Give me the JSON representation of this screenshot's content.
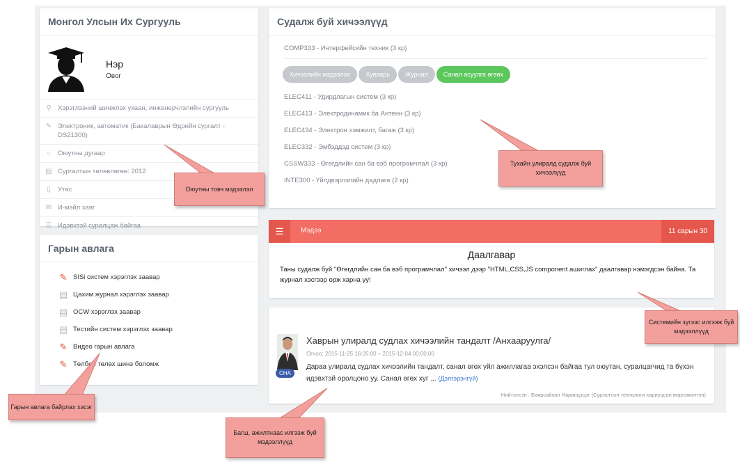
{
  "student": {
    "university": "Монгол Улсын Их Сургууль",
    "name": "Нэр",
    "surname": "Овог",
    "info": [
      {
        "icon": "location-icon",
        "text": "Хэрэглээний шинжлэх ухаан, инженерчлэлийн сургууль"
      },
      {
        "icon": "pencil-icon",
        "text": "Электроник, автоматик (Бакалаврын Өдрийн сургалт - DS21300)"
      },
      {
        "icon": "id-icon",
        "text": "Оюутны дугаар"
      },
      {
        "icon": "calendar-icon",
        "text": "Сургалтын төлөвлөгөө: 2012"
      },
      {
        "icon": "phone-icon",
        "text": "Утас"
      },
      {
        "icon": "mail-icon",
        "text": "И-мэйл хаяг"
      },
      {
        "icon": "list-icon",
        "text": "Идэвхтэй суралцаж байгаа"
      }
    ]
  },
  "manuals": {
    "title": "Гарын авлага",
    "items": [
      {
        "icon": "pdf-icon",
        "label": "SISi систем хэрэглэх заавар"
      },
      {
        "icon": "doc-icon",
        "label": "Цахим журнал хэрэглэх заавар"
      },
      {
        "icon": "doc-icon",
        "label": "OCW хэрэглэх заавар"
      },
      {
        "icon": "doc-icon",
        "label": "Тестийн систем хэрэглэх заавар"
      },
      {
        "icon": "pdf-icon",
        "label": "Видео гарын авлага"
      },
      {
        "icon": "pdf-icon",
        "label": "Төлбөр төлөх шинэ боломж"
      }
    ]
  },
  "courses": {
    "title": "Судалж буй хичээлүүд",
    "first": "COMP333 - Интерфейсийн техник (3 кр)",
    "tabs": [
      "Хичээлийн мэдээлэл",
      "Хуваарь",
      "Журнал",
      "Санал асуулга өгөөх"
    ],
    "list": [
      "ELEC411 - Удирдлагын систем (3 кр)",
      "ELEC413 - Электродинамик ба Антенн (3 кр)",
      "ELEC434 - Электрон хэмжилт, багаж (3 кр)",
      "ELEC332 - Эмбэддэд систем (3 кр)",
      "CSSW333 - Өгөгдлийн сан ба вэб програмчлал (3 кр)",
      "INTE300 - Үйлдвэрлэлийн дадлага (2 кр)"
    ]
  },
  "notice": {
    "label": "Мэдээ",
    "date": "11 сарын 30",
    "title": "Даалгавар",
    "body": "Таны судалж буй \"Өгөгдлийн сан ба вэб програмчлал\" хичээл дээр \"HTML,CSS,JS component ашиглах\" даалгавар нэмэгдсэн байна. Та журнал хэсгээр орж харна уу!"
  },
  "news": {
    "badge": "CHA",
    "title": "Хаврын улиралд судлах хичээлийн тандалт /Анхааруулга/",
    "dates": "Огноо: 2015-11-25 16:05:00 – 2015-12-04 00:00:00",
    "text": "Дараа улиралд судлах хичээлийн тандалт, санал өгөх үйл ажиллагаа эхэлсэн байгаа тул оюутан, суралцагчид та бүхэн идэвхтэй оролцоно уу. Санал өгөх хуг ...",
    "more": "(Дэлгэрэнгүй)",
    "author": "Нийтэлсэн : Баярсайхан Наранцэцэг (Сургалтын технологи хариуцсан мэргэжилтэн)"
  },
  "callouts": {
    "student_info": "Оюутны товч мэдээлэл",
    "courses": "Тухайн улиралд судалж буй хичээлүүд",
    "system": "Системийн зүгээс илгээж буй мэдээллүүд",
    "manuals": "Гарын авлага байрлах хэсэг",
    "teachers": "Багш, ажилтнаас илгээж буй мэдээллүүд"
  },
  "colors": {
    "notice_bar": "#f26d63",
    "tab_green": "#5cc75c",
    "tab_gray": "#c5c8cc",
    "callout": "#f3a09c"
  }
}
